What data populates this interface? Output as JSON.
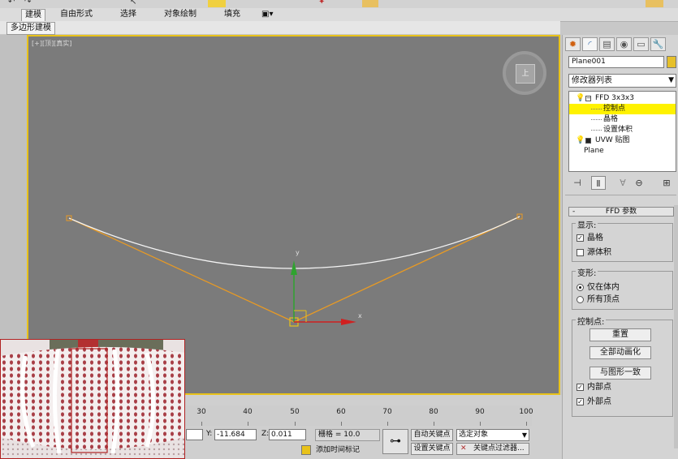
{
  "ribbon": {
    "tabs": [
      "建模",
      "自由形式",
      "选择",
      "对象绘制",
      "填充"
    ],
    "active_tab": "建模",
    "subtab": "多边形建模"
  },
  "viewport": {
    "label": "[+][顶][真实]",
    "viewcube_face": "上",
    "axis_x": "x",
    "axis_y": "y"
  },
  "command_panel": {
    "object_name": "Plane001",
    "object_color": "#e6c02a",
    "modifier_list": "修改器列表",
    "stack": [
      {
        "label": "FFD 3x3x3",
        "level": 0,
        "selected": false
      },
      {
        "label": "控制点",
        "level": 1,
        "selected": true
      },
      {
        "label": "晶格",
        "level": 1,
        "selected": false
      },
      {
        "label": "设置体积",
        "level": 1,
        "selected": false
      },
      {
        "label": "UVW 贴图",
        "level": 0,
        "selected": false
      },
      {
        "label": "Plane",
        "level": 0,
        "selected": false
      }
    ],
    "rollout_title": "FFD 参数",
    "display_group": {
      "title": "显示:",
      "lattice": "晶格",
      "source_volume": "源体积"
    },
    "deform_group": {
      "title": "变形:",
      "inside_volume": "仅在体内",
      "all_vertices": "所有顶点"
    },
    "control_points_group": {
      "title": "控制点:",
      "reset": "重置",
      "animate_all": "全部动画化",
      "conform_to_shape": "与图形一致",
      "inside_points": "内部点",
      "outside_points": "外部点"
    }
  },
  "timeline": {
    "ticks": [
      "30",
      "40",
      "50",
      "60",
      "70",
      "80",
      "90",
      "100"
    ]
  },
  "status": {
    "y_label": "Y:",
    "y_value": "-11.684",
    "z_label": "Z:",
    "z_value": "0.011",
    "grid": "栅格 = 10.0",
    "add_time_tag": "添加时间标记",
    "auto_key": "自动关键点",
    "set_key": "设置关键点",
    "selection_set": "选定对象",
    "key_filters": "关键点过滤器..."
  }
}
